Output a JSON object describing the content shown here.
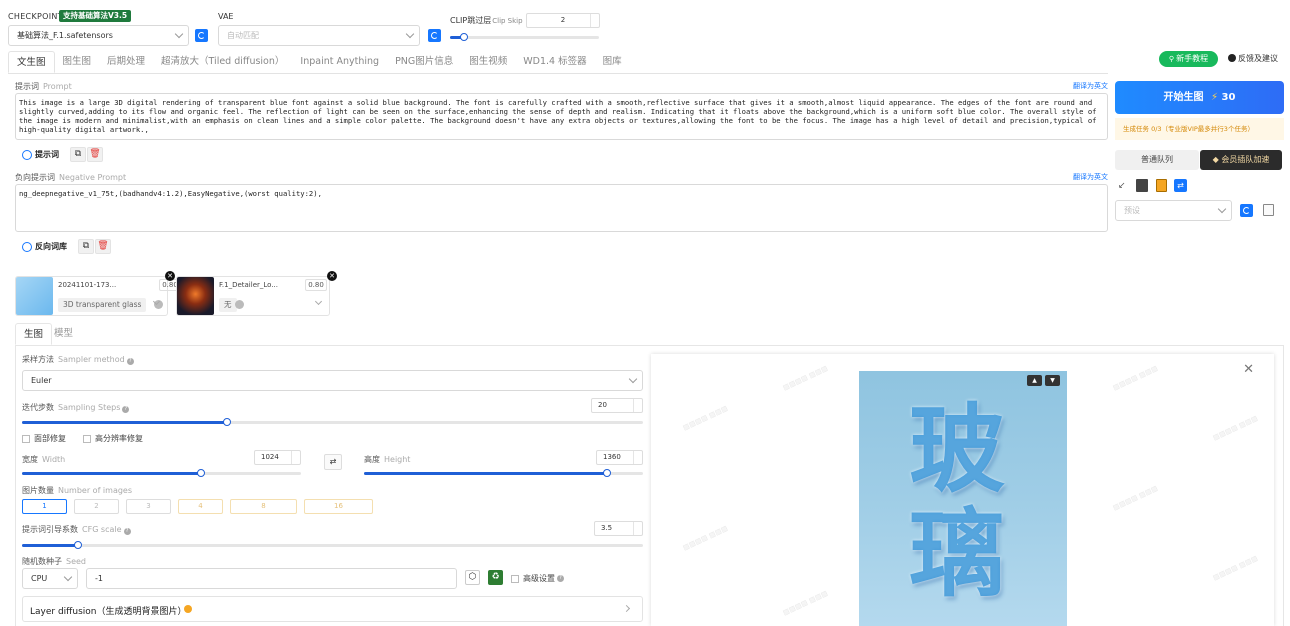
{
  "header": {
    "checkpoint_label": "CHECKPOINT",
    "checkpoint_badge": "支持基础算法V3.5",
    "checkpoint_value": "基础算法_F.1.safetensors",
    "vae_label": "VAE",
    "vae_placeholder": "自动匹配",
    "clip_label": "CLIP跳过层",
    "clip_label_en": "Clip Skip",
    "clip_value": "2"
  },
  "tabs": [
    {
      "label": "文生图"
    },
    {
      "label": "图生图"
    },
    {
      "label": "后期处理"
    },
    {
      "label": "超清放大（Tiled diffusion）"
    },
    {
      "label": "Inpaint Anything"
    },
    {
      "label": "PNG图片信息"
    },
    {
      "label": "图生视频"
    },
    {
      "label": "WD1.4 标签器"
    },
    {
      "label": "图库"
    }
  ],
  "topright": {
    "tutorial": "新手教程",
    "feedback": "反馈及建议"
  },
  "prompt": {
    "label": "提示词",
    "label_en": "Prompt",
    "translate": "翻译为英文",
    "text": "This image is a large 3D digital rendering of transparent blue font against a solid blue background. The font is carefully crafted with a smooth,reflective surface that gives it a smooth,almost liquid appearance. The edges of the font are round and slightly curved,adding to its flow and organic feel. The reflection of light can be seen on the surface,enhancing the sense of depth and realism. Indicating that it floats above the background,which is a uniform soft blue color. The overall style of the image is modern and minimalist,with an emphasis on clean lines and a simple color palette. The background doesn't have any extra objects or textures,allowing the font to be the focus. The image has a high level of detail and precision,typical of high-quality digital artwork.,",
    "tool_label": "提示词"
  },
  "negative": {
    "label": "负向提示词",
    "label_en": "Negative Prompt",
    "translate": "翻译为英文",
    "text": "ng_deepnegative_v1_75t,(badhandv4:1.2),EasyNegative,(worst quality:2),",
    "tool_label": "反向词库"
  },
  "loras": [
    {
      "name": "20241101-173...",
      "weight": "0.80",
      "tag": "3D transparent glass"
    },
    {
      "name": "F.1_Detailer_Lo...",
      "weight": "0.80",
      "tag": "无"
    }
  ],
  "right": {
    "generate_label": "开始生图",
    "generate_cost": "30",
    "task_info": "生成任务 0/3（专业版VIP最多并行3个任务）",
    "queue_normal": "普通队列",
    "queue_vip": "会员插队加速",
    "preset_placeholder": "预设"
  },
  "subtabs": [
    {
      "label": "生图"
    },
    {
      "label": "模型"
    }
  ],
  "params": {
    "sampler_label": "采样方法",
    "sampler_label_en": "Sampler method",
    "sampler_value": "Euler",
    "steps_label": "迭代步数",
    "steps_label_en": "Sampling Steps",
    "steps_value": "20",
    "steps_fraction": 0.33,
    "face_fix": "面部修复",
    "hires_fix": "高分辨率修复",
    "width_label": "宽度",
    "width_label_en": "Width",
    "width_value": "1024",
    "width_fraction": 0.64,
    "height_label": "高度",
    "height_label_en": "Height",
    "height_value": "1360",
    "height_fraction": 0.87,
    "count_label": "图片数量",
    "count_label_en": "Number of images",
    "counts": [
      "1",
      "2",
      "3",
      "4",
      "8",
      "16"
    ],
    "cfg_label": "提示词引导系数",
    "cfg_label_en": "CFG scale",
    "cfg_value": "3.5",
    "cfg_fraction": 0.09,
    "seed_label": "随机数种子",
    "seed_label_en": "Seed",
    "seed_device": "CPU",
    "seed_value": "-1",
    "advanced": "高级设置",
    "layer_diffusion": "Layer diffusion（生成透明背景图片）"
  },
  "preview": {
    "text_line1": "玻",
    "text_line2": "璃"
  },
  "colors": {
    "accent": "#1677ff",
    "green": "#18b95c",
    "gold": "#f5a623"
  }
}
